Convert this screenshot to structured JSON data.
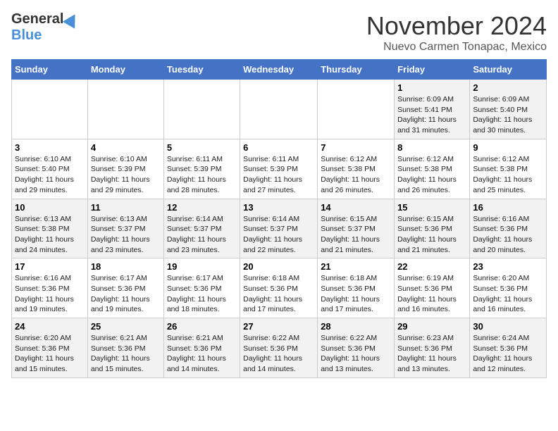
{
  "header": {
    "logo_general": "General",
    "logo_blue": "Blue",
    "month_title": "November 2024",
    "location": "Nuevo Carmen Tonapac, Mexico"
  },
  "days_of_week": [
    "Sunday",
    "Monday",
    "Tuesday",
    "Wednesday",
    "Thursday",
    "Friday",
    "Saturday"
  ],
  "weeks": [
    [
      {
        "day": "",
        "info": ""
      },
      {
        "day": "",
        "info": ""
      },
      {
        "day": "",
        "info": ""
      },
      {
        "day": "",
        "info": ""
      },
      {
        "day": "",
        "info": ""
      },
      {
        "day": "1",
        "info": "Sunrise: 6:09 AM\nSunset: 5:41 PM\nDaylight: 11 hours and 31 minutes."
      },
      {
        "day": "2",
        "info": "Sunrise: 6:09 AM\nSunset: 5:40 PM\nDaylight: 11 hours and 30 minutes."
      }
    ],
    [
      {
        "day": "3",
        "info": "Sunrise: 6:10 AM\nSunset: 5:40 PM\nDaylight: 11 hours and 29 minutes."
      },
      {
        "day": "4",
        "info": "Sunrise: 6:10 AM\nSunset: 5:39 PM\nDaylight: 11 hours and 29 minutes."
      },
      {
        "day": "5",
        "info": "Sunrise: 6:11 AM\nSunset: 5:39 PM\nDaylight: 11 hours and 28 minutes."
      },
      {
        "day": "6",
        "info": "Sunrise: 6:11 AM\nSunset: 5:39 PM\nDaylight: 11 hours and 27 minutes."
      },
      {
        "day": "7",
        "info": "Sunrise: 6:12 AM\nSunset: 5:38 PM\nDaylight: 11 hours and 26 minutes."
      },
      {
        "day": "8",
        "info": "Sunrise: 6:12 AM\nSunset: 5:38 PM\nDaylight: 11 hours and 26 minutes."
      },
      {
        "day": "9",
        "info": "Sunrise: 6:12 AM\nSunset: 5:38 PM\nDaylight: 11 hours and 25 minutes."
      }
    ],
    [
      {
        "day": "10",
        "info": "Sunrise: 6:13 AM\nSunset: 5:38 PM\nDaylight: 11 hours and 24 minutes."
      },
      {
        "day": "11",
        "info": "Sunrise: 6:13 AM\nSunset: 5:37 PM\nDaylight: 11 hours and 23 minutes."
      },
      {
        "day": "12",
        "info": "Sunrise: 6:14 AM\nSunset: 5:37 PM\nDaylight: 11 hours and 23 minutes."
      },
      {
        "day": "13",
        "info": "Sunrise: 6:14 AM\nSunset: 5:37 PM\nDaylight: 11 hours and 22 minutes."
      },
      {
        "day": "14",
        "info": "Sunrise: 6:15 AM\nSunset: 5:37 PM\nDaylight: 11 hours and 21 minutes."
      },
      {
        "day": "15",
        "info": "Sunrise: 6:15 AM\nSunset: 5:36 PM\nDaylight: 11 hours and 21 minutes."
      },
      {
        "day": "16",
        "info": "Sunrise: 6:16 AM\nSunset: 5:36 PM\nDaylight: 11 hours and 20 minutes."
      }
    ],
    [
      {
        "day": "17",
        "info": "Sunrise: 6:16 AM\nSunset: 5:36 PM\nDaylight: 11 hours and 19 minutes."
      },
      {
        "day": "18",
        "info": "Sunrise: 6:17 AM\nSunset: 5:36 PM\nDaylight: 11 hours and 19 minutes."
      },
      {
        "day": "19",
        "info": "Sunrise: 6:17 AM\nSunset: 5:36 PM\nDaylight: 11 hours and 18 minutes."
      },
      {
        "day": "20",
        "info": "Sunrise: 6:18 AM\nSunset: 5:36 PM\nDaylight: 11 hours and 17 minutes."
      },
      {
        "day": "21",
        "info": "Sunrise: 6:18 AM\nSunset: 5:36 PM\nDaylight: 11 hours and 17 minutes."
      },
      {
        "day": "22",
        "info": "Sunrise: 6:19 AM\nSunset: 5:36 PM\nDaylight: 11 hours and 16 minutes."
      },
      {
        "day": "23",
        "info": "Sunrise: 6:20 AM\nSunset: 5:36 PM\nDaylight: 11 hours and 16 minutes."
      }
    ],
    [
      {
        "day": "24",
        "info": "Sunrise: 6:20 AM\nSunset: 5:36 PM\nDaylight: 11 hours and 15 minutes."
      },
      {
        "day": "25",
        "info": "Sunrise: 6:21 AM\nSunset: 5:36 PM\nDaylight: 11 hours and 15 minutes."
      },
      {
        "day": "26",
        "info": "Sunrise: 6:21 AM\nSunset: 5:36 PM\nDaylight: 11 hours and 14 minutes."
      },
      {
        "day": "27",
        "info": "Sunrise: 6:22 AM\nSunset: 5:36 PM\nDaylight: 11 hours and 14 minutes."
      },
      {
        "day": "28",
        "info": "Sunrise: 6:22 AM\nSunset: 5:36 PM\nDaylight: 11 hours and 13 minutes."
      },
      {
        "day": "29",
        "info": "Sunrise: 6:23 AM\nSunset: 5:36 PM\nDaylight: 11 hours and 13 minutes."
      },
      {
        "day": "30",
        "info": "Sunrise: 6:24 AM\nSunset: 5:36 PM\nDaylight: 11 hours and 12 minutes."
      }
    ]
  ]
}
